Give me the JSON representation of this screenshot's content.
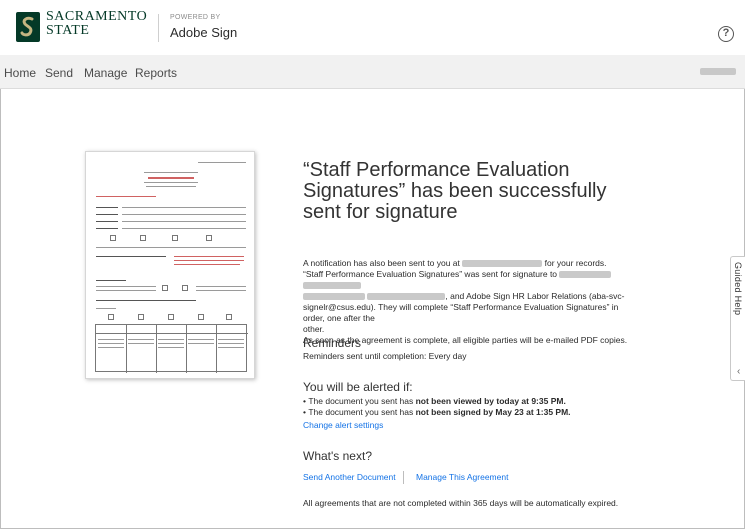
{
  "header": {
    "logo_line1": "SACRAMENTO",
    "logo_line2": "STATE",
    "powered_by": "POWERED BY",
    "product": "Adobe Sign",
    "help_icon": "question-circle-icon",
    "brand_color": "#043927"
  },
  "nav": {
    "items": [
      "Home",
      "Send",
      "Manage",
      "Reports"
    ]
  },
  "confirmation": {
    "title": "“Staff Performance Evaluation Signatures” has been successfully sent for signature",
    "notice_part1": "A notification has also been sent to you at",
    "notice_part2": "for your records.",
    "sent_line_part1": "“Staff Performance Evaluation Signatures” was sent for signature to",
    "sent_line_part2": ", and Adobe Sign HR Labor Relations (aba-svc-",
    "sent_line_part3": "signelr@csus.edu). They will complete “Staff Performance Evaluation Signatures” in order, one after the",
    "sent_line_part4": "other.",
    "complete_notice": "As soon as the agreement is complete, all eligible parties will be e-mailed PDF copies."
  },
  "reminders": {
    "heading": "Reminders",
    "text": "Reminders sent until completion: Every day"
  },
  "alerts": {
    "heading": "You will be alerted if:",
    "item1_pre": "The document you sent has ",
    "item1_bold": "not been viewed by today at 9:35 PM.",
    "item2_pre": "The document you sent has ",
    "item2_bold": "not been signed by May 23 at 1:35 PM.",
    "change_link": "Change alert settings"
  },
  "next": {
    "heading": "What's next?",
    "send_another": "Send Another Document",
    "manage": "Manage This Agreement",
    "expiry_note": "All agreements that are not completed within 365 days will be automatically expired."
  },
  "guided_help": {
    "label": "Guided Help",
    "icon": "chevron-left-icon"
  },
  "link_color": "#1473e6"
}
